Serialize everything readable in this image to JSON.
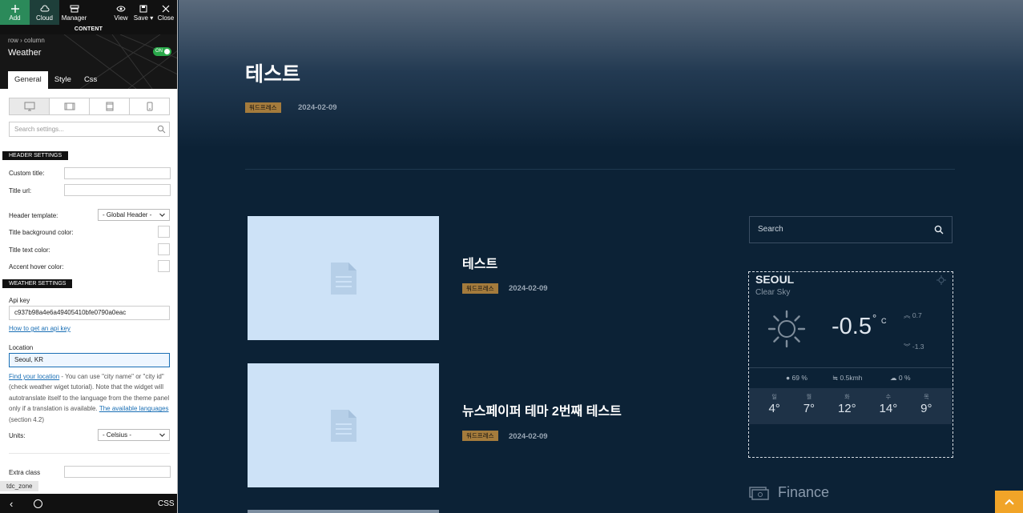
{
  "toolbar": {
    "add": "Add",
    "cloud": "Cloud",
    "manager": "Manager",
    "view": "View",
    "save": "Save",
    "close": "Close",
    "content_label": "CONTENT"
  },
  "element": {
    "breadcrumb": "row › column",
    "title": "Weather",
    "toggle": "ON",
    "tabs": [
      "General",
      "Style",
      "Css"
    ]
  },
  "settings": {
    "search_placeholder": "Search settings...",
    "header_section": "HEADER SETTINGS",
    "custom_title_label": "Custom title:",
    "custom_title_value": "",
    "title_url_label": "Title url:",
    "title_url_value": "",
    "header_template_label": "Header template:",
    "header_template_value": "- Global Header -",
    "title_bg_label": "Title background color:",
    "title_text_label": "Title text color:",
    "accent_hover_label": "Accent hover color:",
    "weather_section": "WEATHER SETTINGS",
    "api_key_label": "Api key",
    "api_key_value": "c937b98a4e6a49405410bfe0790a0eac",
    "api_key_link": "How to get an api key",
    "location_label": "Location",
    "location_value": "Seoul, KR",
    "find_location_link": "Find your location",
    "location_desc": " - You can use \"city name\" or \"city id\" (check weather wiget tutorial). Note that the widget will autotranslate itself to the language from the theme panel only if a translation is available. ",
    "languages_link": "The available languages",
    "location_desc_end": " (section 4.2)",
    "units_label": "Units:",
    "units_value": "- Celsius -",
    "extra_class_label": "Extra class",
    "extra_class_value": ""
  },
  "footer": {
    "zone": "tdc_zone",
    "css": "CSS"
  },
  "page": {
    "title": "테스트",
    "category": "워드프레스",
    "date": "2024-02-09",
    "posts": [
      {
        "title": "테스트",
        "category": "워드프레스",
        "date": "2024-02-09"
      },
      {
        "title": "뉴스페이퍼 테마 2번째 테스트",
        "category": "워드프레스",
        "date": "2024-02-09"
      }
    ],
    "search_label": "Search",
    "finance_title": "Finance"
  },
  "weather": {
    "city": "SEOUL",
    "condition": "Clear Sky",
    "temp": "-0.5",
    "unit": "°",
    "unit_c": "C",
    "high": "0.7",
    "low": "-1.3",
    "humidity": "69 %",
    "wind": "0.5kmh",
    "clouds": "0 %",
    "forecast": [
      {
        "day": "일",
        "temp": "4°"
      },
      {
        "day": "월",
        "temp": "7°"
      },
      {
        "day": "화",
        "temp": "12°"
      },
      {
        "day": "수",
        "temp": "14°"
      },
      {
        "day": "목",
        "temp": "9°"
      }
    ]
  },
  "colors": {
    "add": "#2b8a5a",
    "toggle_on": "#2aa84a",
    "category_badge": "#a47b3c",
    "back_to_top": "#f1a428",
    "page_bg": "#0c2236"
  }
}
